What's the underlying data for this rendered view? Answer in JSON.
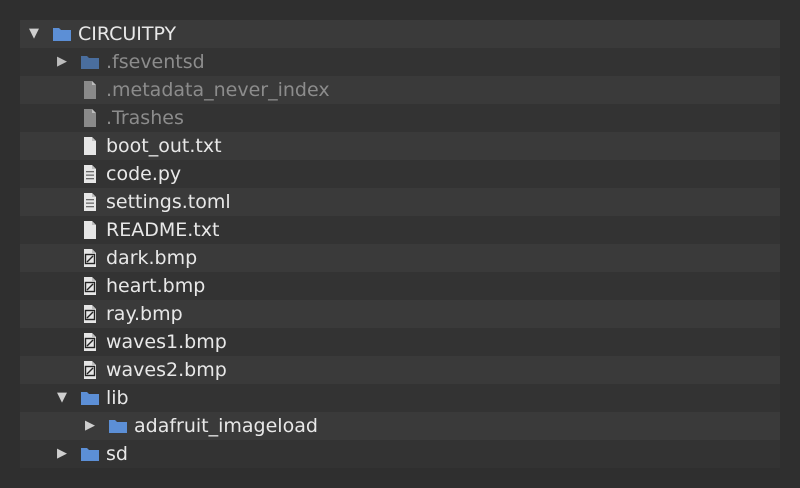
{
  "colors": {
    "panel": "#3a3a3a",
    "row_alt": "#333333",
    "text": "#e8e8e8",
    "text_dim": "#8c8c8c",
    "folder": "#5c8fd6",
    "folder_dim": "#4a6e9e",
    "file": "#e6e6e6",
    "file_dim": "#8a8a8a"
  },
  "tree": [
    {
      "id": "circuitpy",
      "name": "CIRCUITPY",
      "type": "folder",
      "depth": 0,
      "expanded": true,
      "dim": false
    },
    {
      "id": "fseventsd",
      "name": ".fseventsd",
      "type": "folder",
      "depth": 1,
      "expanded": false,
      "dim": true
    },
    {
      "id": "metadata-never-index",
      "name": ".metadata_never_index",
      "type": "file",
      "depth": 1,
      "dim": true
    },
    {
      "id": "trashes",
      "name": ".Trashes",
      "type": "file",
      "depth": 1,
      "dim": true
    },
    {
      "id": "boot-out",
      "name": "boot_out.txt",
      "type": "file",
      "depth": 1,
      "dim": false
    },
    {
      "id": "code-py",
      "name": "code.py",
      "type": "code",
      "depth": 1,
      "dim": false
    },
    {
      "id": "settings-toml",
      "name": "settings.toml",
      "type": "code",
      "depth": 1,
      "dim": false
    },
    {
      "id": "readme",
      "name": "README.txt",
      "type": "file",
      "depth": 1,
      "dim": false
    },
    {
      "id": "dark-bmp",
      "name": "dark.bmp",
      "type": "image",
      "depth": 1,
      "dim": false
    },
    {
      "id": "heart-bmp",
      "name": "heart.bmp",
      "type": "image",
      "depth": 1,
      "dim": false
    },
    {
      "id": "ray-bmp",
      "name": "ray.bmp",
      "type": "image",
      "depth": 1,
      "dim": false
    },
    {
      "id": "waves1-bmp",
      "name": "waves1.bmp",
      "type": "image",
      "depth": 1,
      "dim": false
    },
    {
      "id": "waves2-bmp",
      "name": "waves2.bmp",
      "type": "image",
      "depth": 1,
      "dim": false
    },
    {
      "id": "lib",
      "name": "lib",
      "type": "folder",
      "depth": 1,
      "expanded": true,
      "dim": false
    },
    {
      "id": "adafruit-imageload",
      "name": "adafruit_imageload",
      "type": "folder",
      "depth": 2,
      "expanded": false,
      "dim": false
    },
    {
      "id": "sd",
      "name": "sd",
      "type": "folder",
      "depth": 1,
      "expanded": false,
      "dim": false
    }
  ],
  "icons": {
    "expanded": "▼",
    "collapsed": "▶",
    "folder": "folder-icon",
    "file": "file-icon",
    "code": "code-file-icon",
    "image": "image-file-icon"
  }
}
